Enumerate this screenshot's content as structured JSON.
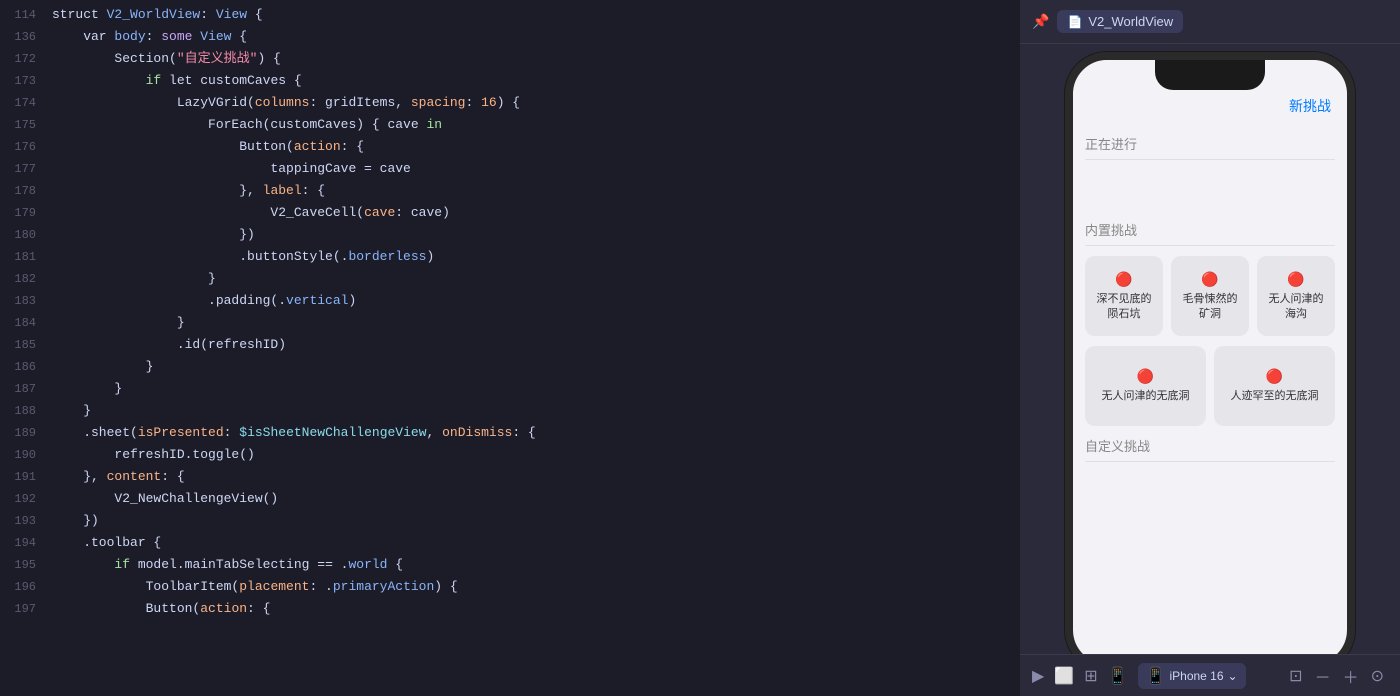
{
  "editor": {
    "lines": [
      {
        "num": "114",
        "tokens": [
          {
            "t": "plain",
            "v": "struct "
          },
          {
            "t": "kw-blue",
            "v": "V2_WorldView"
          },
          {
            "t": "plain",
            "v": ": "
          },
          {
            "t": "kw-blue",
            "v": "View"
          },
          {
            "t": "plain",
            "v": " {"
          }
        ]
      },
      {
        "num": "136",
        "tokens": [
          {
            "t": "plain",
            "v": "    var "
          },
          {
            "t": "kw-blue",
            "v": "body"
          },
          {
            "t": "plain",
            "v": ": "
          },
          {
            "t": "kw-struct",
            "v": "some"
          },
          {
            "t": "plain",
            "v": " "
          },
          {
            "t": "kw-blue",
            "v": "View"
          },
          {
            "t": "plain",
            "v": " {"
          }
        ]
      },
      {
        "num": "172",
        "tokens": [
          {
            "t": "plain",
            "v": "        Section("
          },
          {
            "t": "str-red",
            "v": "\"自定义挑战\""
          },
          {
            "t": "plain",
            "v": ") {"
          }
        ]
      },
      {
        "num": "173",
        "tokens": [
          {
            "t": "plain",
            "v": "            "
          },
          {
            "t": "kw-green",
            "v": "if"
          },
          {
            "t": "plain",
            "v": " let customCaves {"
          }
        ]
      },
      {
        "num": "174",
        "tokens": [
          {
            "t": "plain",
            "v": "                LazyVGrid("
          },
          {
            "t": "kw-orange",
            "v": "columns"
          },
          {
            "t": "plain",
            "v": ": gridItems, "
          },
          {
            "t": "kw-orange",
            "v": "spacing"
          },
          {
            "t": "plain",
            "v": ": "
          },
          {
            "t": "num",
            "v": "16"
          },
          {
            "t": "plain",
            "v": ") {"
          }
        ]
      },
      {
        "num": "175",
        "tokens": [
          {
            "t": "plain",
            "v": "                    ForEach(customCaves) { cave "
          },
          {
            "t": "kw-green",
            "v": "in"
          }
        ]
      },
      {
        "num": "176",
        "tokens": [
          {
            "t": "plain",
            "v": "                        Button("
          },
          {
            "t": "kw-orange",
            "v": "action"
          },
          {
            "t": "plain",
            "v": ": {"
          }
        ]
      },
      {
        "num": "177",
        "tokens": [
          {
            "t": "plain",
            "v": "                            tappingCave = cave"
          }
        ]
      },
      {
        "num": "178",
        "tokens": [
          {
            "t": "plain",
            "v": "                        }, "
          },
          {
            "t": "kw-orange",
            "v": "label"
          },
          {
            "t": "plain",
            "v": ": {"
          }
        ]
      },
      {
        "num": "179",
        "tokens": [
          {
            "t": "plain",
            "v": "                            V2_CaveCell("
          },
          {
            "t": "kw-orange",
            "v": "cave"
          },
          {
            "t": "plain",
            "v": ": cave)"
          }
        ]
      },
      {
        "num": "180",
        "tokens": [
          {
            "t": "plain",
            "v": "                        })"
          }
        ]
      },
      {
        "num": "181",
        "tokens": [
          {
            "t": "plain",
            "v": "                        .buttonStyle(."
          },
          {
            "t": "kw-blue",
            "v": "borderless"
          },
          {
            "t": "plain",
            "v": ")"
          }
        ]
      },
      {
        "num": "182",
        "tokens": [
          {
            "t": "plain",
            "v": "                    }"
          }
        ]
      },
      {
        "num": "183",
        "tokens": [
          {
            "t": "plain",
            "v": "                    .padding(."
          },
          {
            "t": "kw-blue",
            "v": "vertical"
          },
          {
            "t": "plain",
            "v": ")"
          }
        ]
      },
      {
        "num": "184",
        "tokens": [
          {
            "t": "plain",
            "v": "                }"
          }
        ]
      },
      {
        "num": "185",
        "tokens": [
          {
            "t": "plain",
            "v": "                .id(refreshID)"
          }
        ]
      },
      {
        "num": "186",
        "tokens": [
          {
            "t": "plain",
            "v": "            }"
          }
        ]
      },
      {
        "num": "187",
        "tokens": [
          {
            "t": "plain",
            "v": "        }"
          }
        ]
      },
      {
        "num": "188",
        "tokens": [
          {
            "t": "plain",
            "v": "    }"
          }
        ]
      },
      {
        "num": "189",
        "tokens": [
          {
            "t": "plain",
            "v": "    .sheet("
          },
          {
            "t": "kw-orange",
            "v": "isPresented"
          },
          {
            "t": "plain",
            "v": ": "
          },
          {
            "t": "dollar",
            "v": "$isSheetNewChallengeView"
          },
          {
            "t": "plain",
            "v": ", "
          },
          {
            "t": "kw-orange",
            "v": "onDismiss"
          },
          {
            "t": "plain",
            "v": ": {"
          }
        ]
      },
      {
        "num": "190",
        "tokens": [
          {
            "t": "plain",
            "v": "        refreshID.toggle()"
          }
        ]
      },
      {
        "num": "191",
        "tokens": [
          {
            "t": "plain",
            "v": "    }, "
          },
          {
            "t": "kw-orange",
            "v": "content"
          },
          {
            "t": "plain",
            "v": ": {"
          }
        ]
      },
      {
        "num": "192",
        "tokens": [
          {
            "t": "plain",
            "v": "        V2_NewChallengeView()"
          }
        ]
      },
      {
        "num": "193",
        "tokens": [
          {
            "t": "plain",
            "v": "    })"
          }
        ]
      },
      {
        "num": "194",
        "tokens": [
          {
            "t": "plain",
            "v": "    .toolbar {"
          }
        ]
      },
      {
        "num": "195",
        "tokens": [
          {
            "t": "plain",
            "v": "        "
          },
          {
            "t": "kw-green",
            "v": "if"
          },
          {
            "t": "plain",
            "v": " model.mainTabSelecting == ."
          },
          {
            "t": "kw-blue",
            "v": "world"
          },
          {
            "t": "plain",
            "v": " {"
          }
        ]
      },
      {
        "num": "196",
        "tokens": [
          {
            "t": "plain",
            "v": "            ToolbarItem("
          },
          {
            "t": "kw-orange",
            "v": "placement"
          },
          {
            "t": "plain",
            "v": ": ."
          },
          {
            "t": "kw-blue",
            "v": "primaryAction"
          },
          {
            "t": "plain",
            "v": ") {"
          }
        ]
      },
      {
        "num": "197",
        "tokens": [
          {
            "t": "plain",
            "v": "            Button("
          },
          {
            "t": "kw-orange",
            "v": "action"
          },
          {
            "t": "plain",
            "v": ": {"
          }
        ]
      }
    ]
  },
  "preview": {
    "toolbar": {
      "title": "V2_WorldView",
      "pin_label": "📌"
    },
    "phone": {
      "new_challenge_label": "新挑战",
      "in_progress_label": "正在进行",
      "builtin_label": "内置挑战",
      "custom_label": "自定义挑战",
      "caves": [
        {
          "name": "深不见底的陨石坑",
          "lock": "🔴"
        },
        {
          "name": "毛骨悚然的矿洞",
          "lock": "🔴"
        },
        {
          "name": "无人问津的海沟",
          "lock": "🔴"
        }
      ],
      "caves2": [
        {
          "name": "无人问津的无底洞",
          "lock": "🔴"
        },
        {
          "name": "人迹罕至的无底洞",
          "lock": "🔴"
        }
      ]
    },
    "bottom_toolbar": {
      "device_label": "iPhone 16",
      "chevron": "∨"
    }
  }
}
